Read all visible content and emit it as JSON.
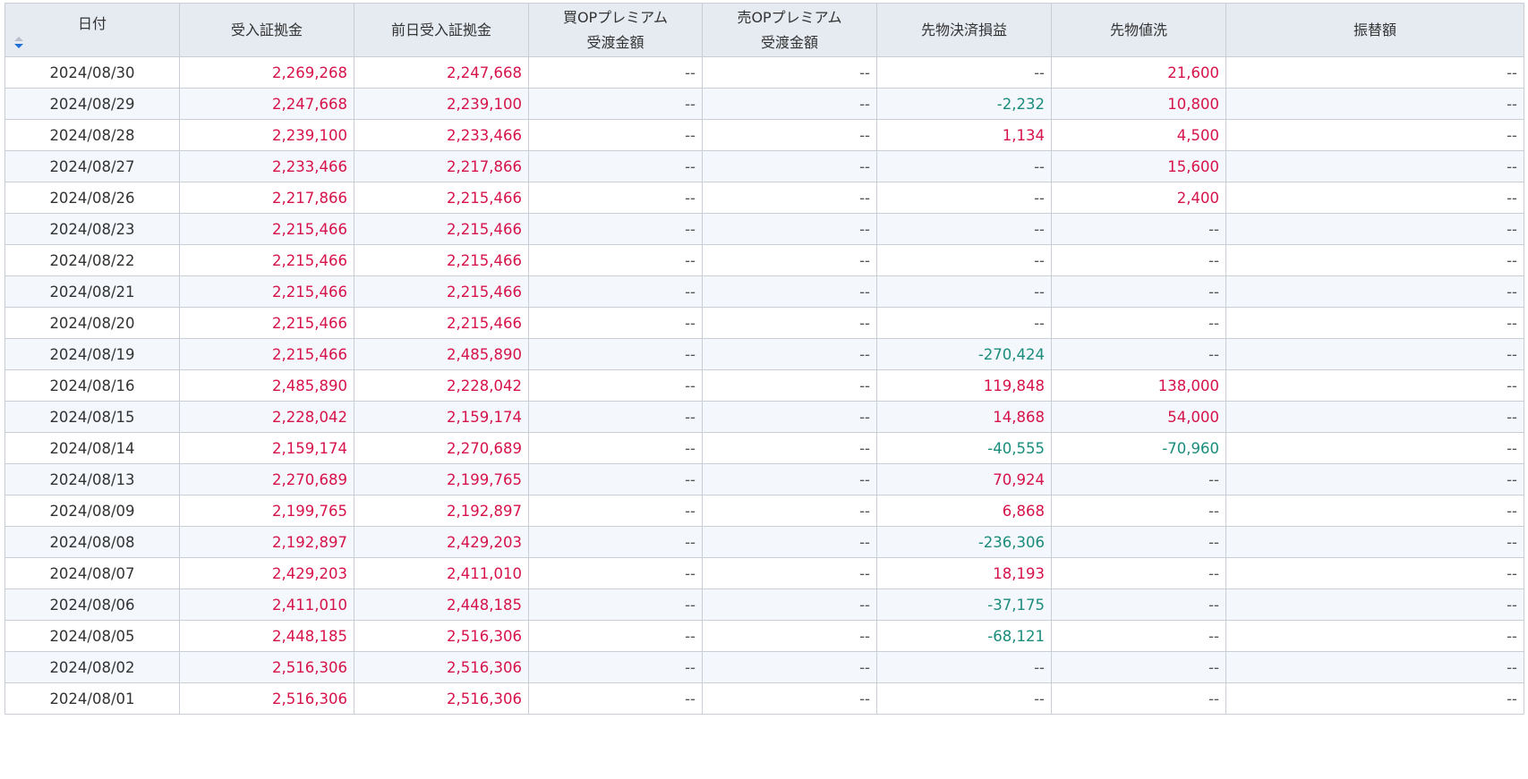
{
  "table": {
    "headers": [
      {
        "key": "date",
        "lines": [
          "日付"
        ],
        "sortable": true,
        "sort_icon": "sort-desc-icon"
      },
      {
        "key": "margin",
        "lines": [
          "受入証拠金"
        ]
      },
      {
        "key": "prev_margin",
        "lines": [
          "前日受入証拠金"
        ]
      },
      {
        "key": "buy_op",
        "lines": [
          "買OPプレミアム",
          "受渡金額"
        ]
      },
      {
        "key": "sell_op",
        "lines": [
          "売OPプレミアム",
          "受渡金額"
        ]
      },
      {
        "key": "futures_pl",
        "lines": [
          "先物決済損益"
        ]
      },
      {
        "key": "futures_mtm",
        "lines": [
          "先物値洗"
        ]
      },
      {
        "key": "transfer",
        "lines": [
          "振替額"
        ]
      }
    ],
    "rows": [
      [
        "2024/08/30",
        "2,269,268",
        "2,247,668",
        "--",
        "--",
        "--",
        "21,600",
        "--"
      ],
      [
        "2024/08/29",
        "2,247,668",
        "2,239,100",
        "--",
        "--",
        "-2,232",
        "10,800",
        "--"
      ],
      [
        "2024/08/28",
        "2,239,100",
        "2,233,466",
        "--",
        "--",
        "1,134",
        "4,500",
        "--"
      ],
      [
        "2024/08/27",
        "2,233,466",
        "2,217,866",
        "--",
        "--",
        "--",
        "15,600",
        "--"
      ],
      [
        "2024/08/26",
        "2,217,866",
        "2,215,466",
        "--",
        "--",
        "--",
        "2,400",
        "--"
      ],
      [
        "2024/08/23",
        "2,215,466",
        "2,215,466",
        "--",
        "--",
        "--",
        "--",
        "--"
      ],
      [
        "2024/08/22",
        "2,215,466",
        "2,215,466",
        "--",
        "--",
        "--",
        "--",
        "--"
      ],
      [
        "2024/08/21",
        "2,215,466",
        "2,215,466",
        "--",
        "--",
        "--",
        "--",
        "--"
      ],
      [
        "2024/08/20",
        "2,215,466",
        "2,215,466",
        "--",
        "--",
        "--",
        "--",
        "--"
      ],
      [
        "2024/08/19",
        "2,215,466",
        "2,485,890",
        "--",
        "--",
        "-270,424",
        "--",
        "--"
      ],
      [
        "2024/08/16",
        "2,485,890",
        "2,228,042",
        "--",
        "--",
        "119,848",
        "138,000",
        "--"
      ],
      [
        "2024/08/15",
        "2,228,042",
        "2,159,174",
        "--",
        "--",
        "14,868",
        "54,000",
        "--"
      ],
      [
        "2024/08/14",
        "2,159,174",
        "2,270,689",
        "--",
        "--",
        "-40,555",
        "-70,960",
        "--"
      ],
      [
        "2024/08/13",
        "2,270,689",
        "2,199,765",
        "--",
        "--",
        "70,924",
        "--",
        "--"
      ],
      [
        "2024/08/09",
        "2,199,765",
        "2,192,897",
        "--",
        "--",
        "6,868",
        "--",
        "--"
      ],
      [
        "2024/08/08",
        "2,192,897",
        "2,429,203",
        "--",
        "--",
        "-236,306",
        "--",
        "--"
      ],
      [
        "2024/08/07",
        "2,429,203",
        "2,411,010",
        "--",
        "--",
        "18,193",
        "--",
        "--"
      ],
      [
        "2024/08/06",
        "2,411,010",
        "2,448,185",
        "--",
        "--",
        "-37,175",
        "--",
        "--"
      ],
      [
        "2024/08/05",
        "2,448,185",
        "2,516,306",
        "--",
        "--",
        "-68,121",
        "--",
        "--"
      ],
      [
        "2024/08/02",
        "2,516,306",
        "2,516,306",
        "--",
        "--",
        "--",
        "--",
        "--"
      ],
      [
        "2024/08/01",
        "2,516,306",
        "2,516,306",
        "--",
        "--",
        "--",
        "--",
        "--"
      ]
    ]
  },
  "colors": {
    "positive": "#d6134a",
    "negative": "#1a8c7c",
    "header_bg": "#e6ebf2",
    "stripe_bg": "#f4f7fc",
    "sort_active": "#1f6fd6"
  }
}
